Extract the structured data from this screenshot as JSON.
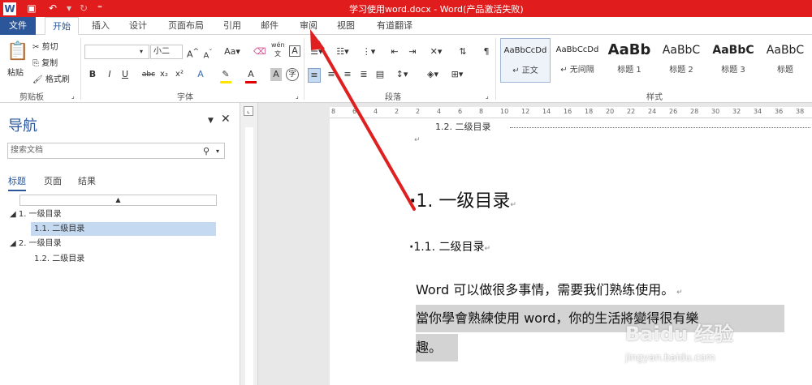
{
  "titlebar": {
    "title": "学习使用word.docx - Word(产品激活失败)",
    "app_icon": "word-icon",
    "quick_access": [
      "save-icon",
      "undo-icon",
      "redo-icon"
    ]
  },
  "tabs": {
    "file": "文件",
    "items": [
      "开始",
      "插入",
      "设计",
      "页面布局",
      "引用",
      "邮件",
      "审阅",
      "视图",
      "有道翻译"
    ],
    "active": "开始"
  },
  "ribbon": {
    "clipboard": {
      "paste": "粘贴",
      "cut": "剪切",
      "copy": "复制",
      "format_painter": "格式刷",
      "label": "剪贴板"
    },
    "font": {
      "font_name": "",
      "font_size": "小二",
      "label": "字体",
      "buttons": [
        "B",
        "I",
        "U",
        "abc",
        "x₂",
        "x²",
        "A",
        "A",
        "A",
        "字"
      ],
      "wen_button": "wén 文"
    },
    "paragraph": {
      "label": "段落"
    },
    "styles": {
      "label": "样式",
      "items": [
        {
          "preview": "AaBbCcDd",
          "name": "↵ 正文",
          "selected": true
        },
        {
          "preview": "AaBbCcDd",
          "name": "↵ 无间隔",
          "selected": false
        },
        {
          "preview": "AaBb",
          "name": "标题 1",
          "selected": false
        },
        {
          "preview": "AaBbC",
          "name": "标题 2",
          "selected": false
        },
        {
          "preview": "AaBbC",
          "name": "标题 3",
          "selected": false
        },
        {
          "preview": "AaBbC",
          "name": "标题",
          "selected": false
        }
      ]
    }
  },
  "nav": {
    "title": "导航",
    "search_placeholder": "搜索文档",
    "tabs": [
      "标题",
      "页面",
      "结果"
    ],
    "active_tab": "标题",
    "tree": [
      {
        "label": "1. 一级目录",
        "level": 1,
        "selected": false
      },
      {
        "label": "1.1. 二级目录",
        "level": 2,
        "selected": true
      },
      {
        "label": "2. 一级目录",
        "level": 1,
        "selected": false
      },
      {
        "label": "1.2. 二级目录",
        "level": 2,
        "selected": false
      }
    ]
  },
  "ruler": {
    "marks": [
      "8",
      "6",
      "4",
      "2",
      "2",
      "4",
      "6",
      "8",
      "10",
      "12",
      "14",
      "16",
      "18",
      "20",
      "22",
      "24",
      "26",
      "28",
      "30",
      "32",
      "34",
      "36",
      "38"
    ]
  },
  "document": {
    "toc_line": "1.2.   二级目录",
    "h1": "1.  一级目录",
    "h2": "1.1.  二级目录",
    "p1": "Word 可以做很多事情，需要我们熟练使用。",
    "p2a": "當你學會熟練使用 word，你的生活將變得很有樂",
    "p2b": "趣。"
  },
  "watermark": {
    "brand": "Baidu 经验",
    "url": "jingyan.baidu.com"
  },
  "colors": {
    "titlebar": "#e11c1c",
    "accent": "#2b579a",
    "arrow": "#e02020"
  }
}
